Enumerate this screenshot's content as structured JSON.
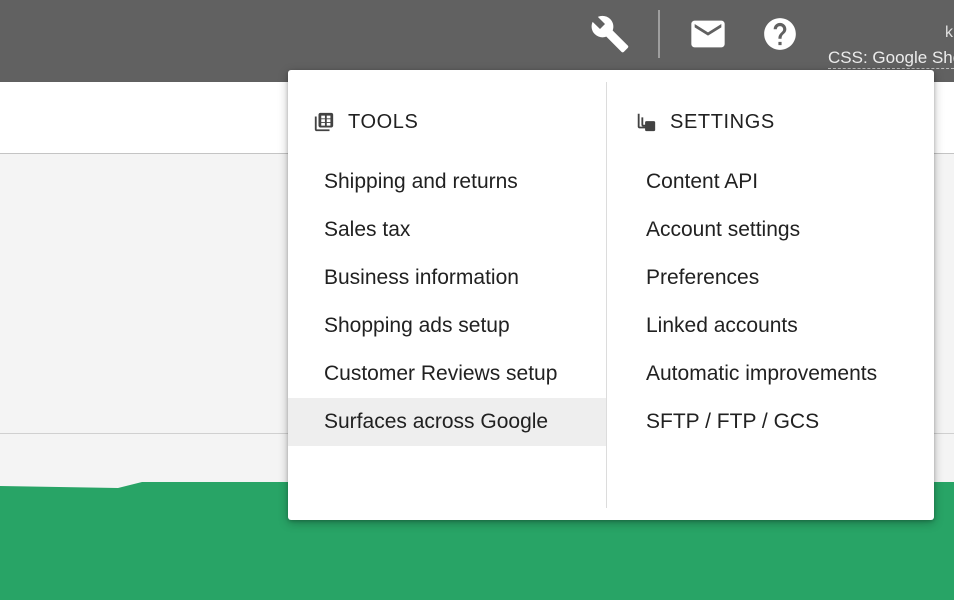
{
  "header": {
    "account_initial": "k",
    "account_name": "CSS: Google Shopping",
    "icons": [
      "wrench-icon",
      "mail-icon",
      "help-icon"
    ]
  },
  "menu": {
    "tools": {
      "title": "TOOLS",
      "icon": "grid-table-icon",
      "items": [
        "Shipping and returns",
        "Sales tax",
        "Business information",
        "Shopping ads setup",
        "Customer Reviews setup",
        "Surfaces across Google"
      ],
      "active_item": "Surfaces across Google"
    },
    "settings": {
      "title": "SETTINGS",
      "icon": "copy-stack-icon",
      "items": [
        "Content API",
        "Account settings",
        "Preferences",
        "Linked accounts",
        "Automatic improvements",
        "SFTP / FTP / GCS"
      ]
    }
  },
  "colors": {
    "topbar": "#616161",
    "chart_fill": "#28a466",
    "menu_active": "#eeeeee"
  }
}
